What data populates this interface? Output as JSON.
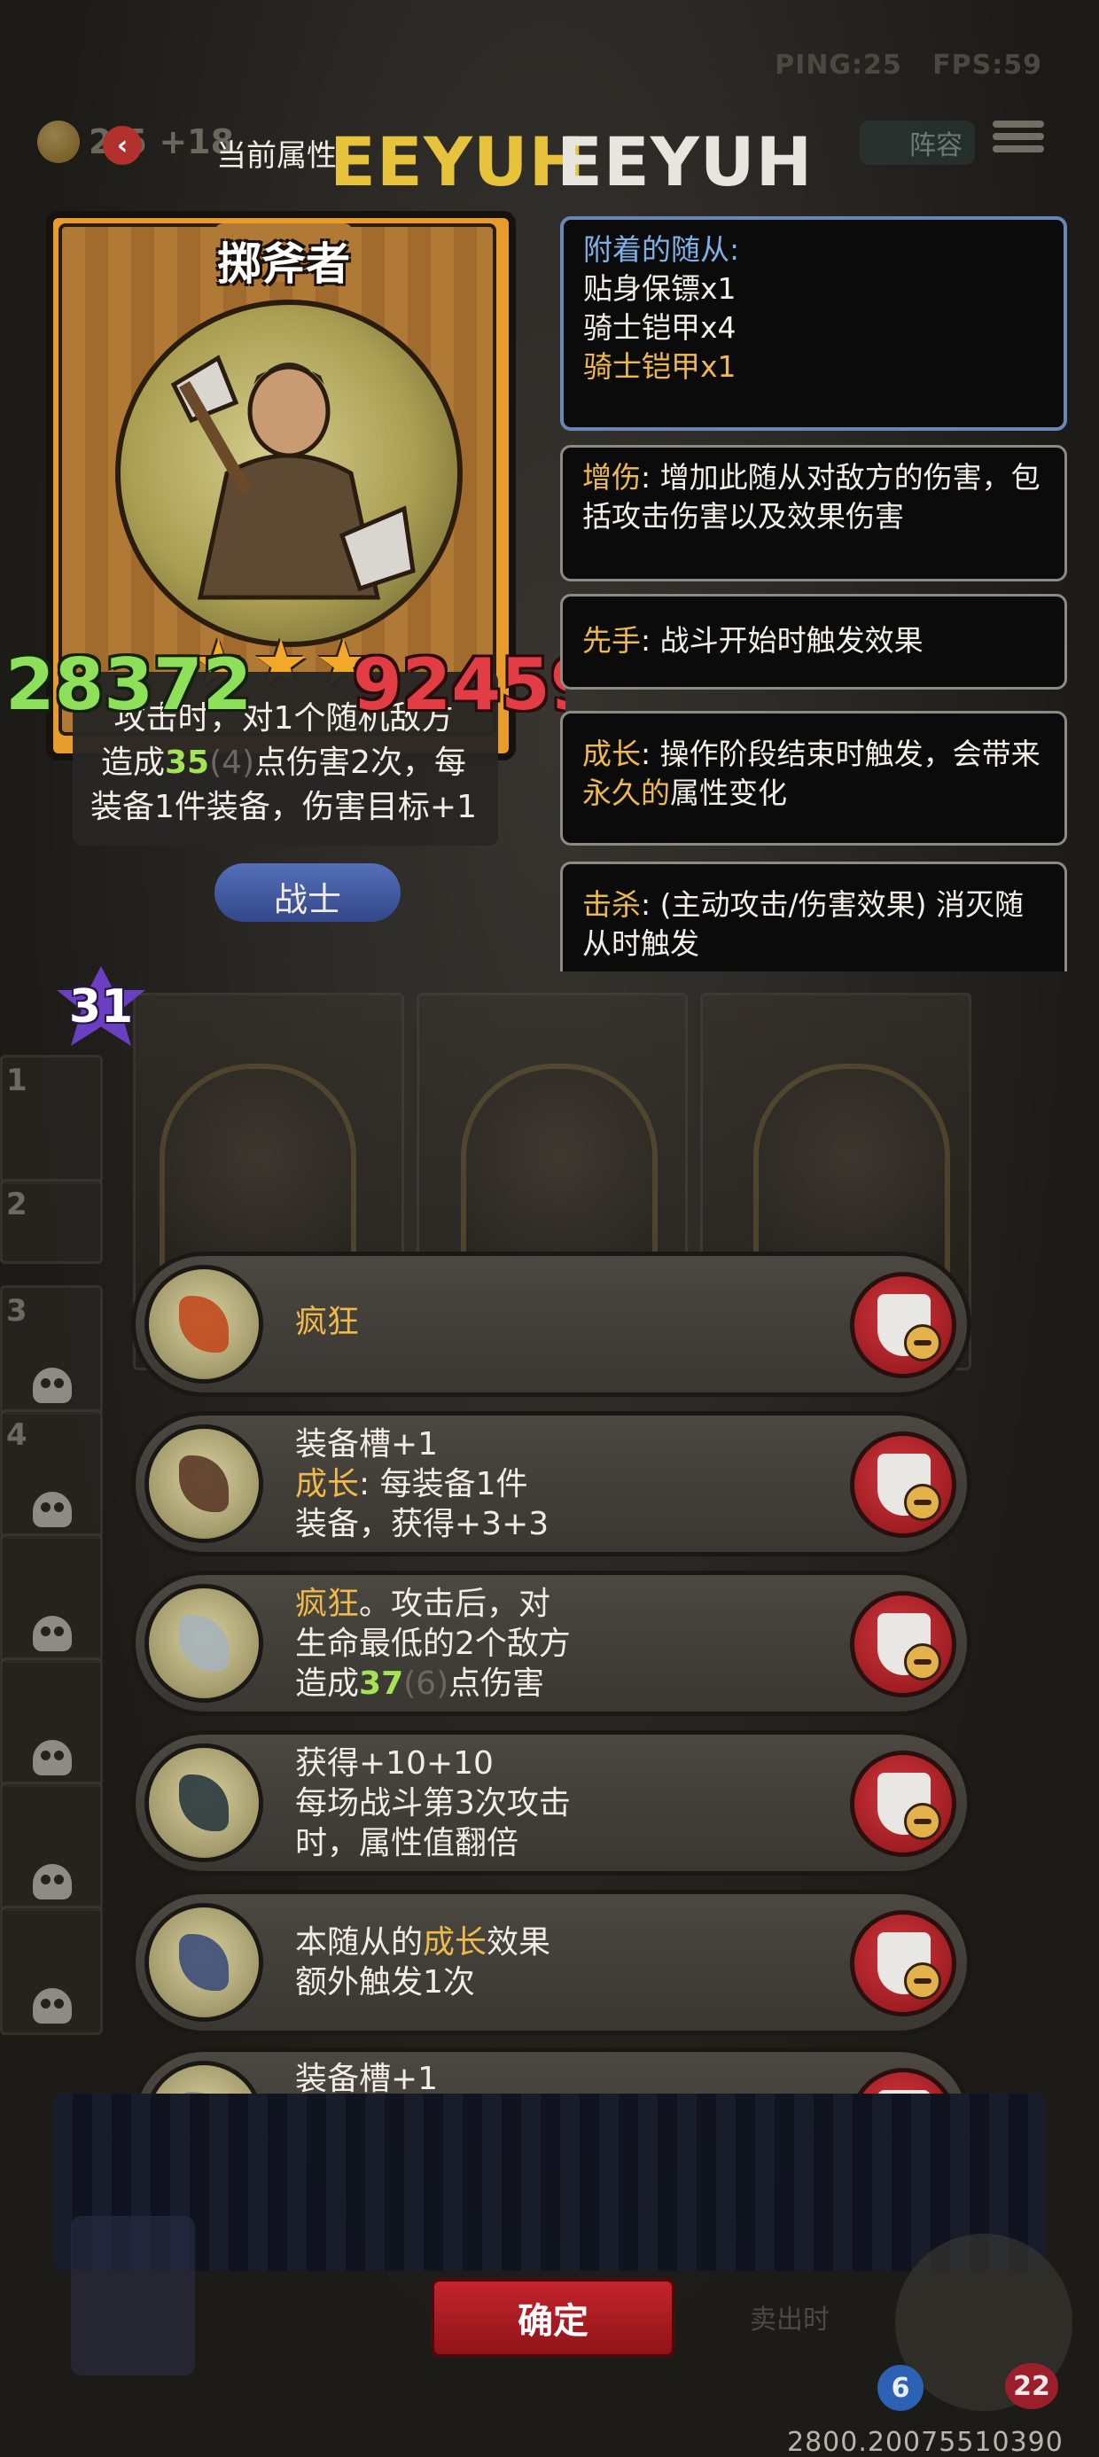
{
  "hud": {
    "ping": "PING:25",
    "fps": "FPS:59",
    "gold": "2 5 +18",
    "current_attr": "当前属性",
    "name_gold": "EEYUH",
    "name_white": "EEYUH",
    "lineup": "阵容"
  },
  "card": {
    "name": "掷斧者",
    "stars": "★★★",
    "desc_line1": "攻击时，对1个随机敌方",
    "desc_line2_pre": "造成",
    "desc_line2_value": "35",
    "desc_line2_paren": "(4)",
    "desc_line2_post": "点伤害2次，每",
    "desc_line3": "装备1件装备，伤害目标+1",
    "class": "战士",
    "attack": "28372",
    "health": "92459",
    "level": "31"
  },
  "keywords": {
    "attached_header": "附着的随从:",
    "attached_items": [
      "贴身保镖x1",
      "骑士铠甲x4"
    ],
    "attached_gold_item": "骑士铠甲x1",
    "boost_term": "增伤",
    "boost_desc": ": 增加此随从对敌方的伤害，包括攻击伤害以及效果伤害",
    "first_term": "先手",
    "first_desc": ": 战斗开始时触发效果",
    "growth_term": "成长",
    "growth_desc_pre": ": 操作阶段结束时触发，会带来",
    "growth_desc_gold": "永久的",
    "growth_desc_post": "属性变化",
    "kill_term": "击杀",
    "kill_desc": ": (主动攻击/伤害效果) 消灭随从时触发"
  },
  "equipment": [
    {
      "line1_gold": "疯狂",
      "icon": "red-claw-icon"
    },
    {
      "line1": "装备槽+1",
      "line2_gold": "成长",
      "line2": ": 每装备1件",
      "line3": "装备，获得+3+3",
      "icon": "armor-vest-icon"
    },
    {
      "line1_gold": "疯狂",
      "line1": "。攻击后，对",
      "line2": "生命最低的2个敌方",
      "line3_pre": "造成",
      "line3_value": "37",
      "line3_paren": "(6)",
      "line3_post": "点伤害",
      "icon": "double-axe-icon"
    },
    {
      "line1": "获得+10+10",
      "line2": "每场战斗第3次攻击",
      "line3": "时，属性值翻倍",
      "icon": "cloaked-figure-icon"
    },
    {
      "line1_pre": "本随从的",
      "line1_gold": "成长",
      "line1_post": "效果",
      "line2": "额外触发1次",
      "icon": "stopwatch-gauntlet-icon"
    },
    {
      "line1": "装备槽+1",
      "icon": "ring-icon"
    }
  ],
  "bottom": {
    "confirm": "确定",
    "sell": "卖出时",
    "badge_blue": "6",
    "badge_red": "22",
    "footer_numbers": "2800.20075510390"
  },
  "side_numbers": [
    "1",
    "2",
    "3",
    "4"
  ],
  "colors": {
    "gold_text": "#f0b94c",
    "green_value": "#a4e356",
    "attack": "#8ee05a",
    "health": "#e23c45",
    "confirm": "#c4242b"
  }
}
